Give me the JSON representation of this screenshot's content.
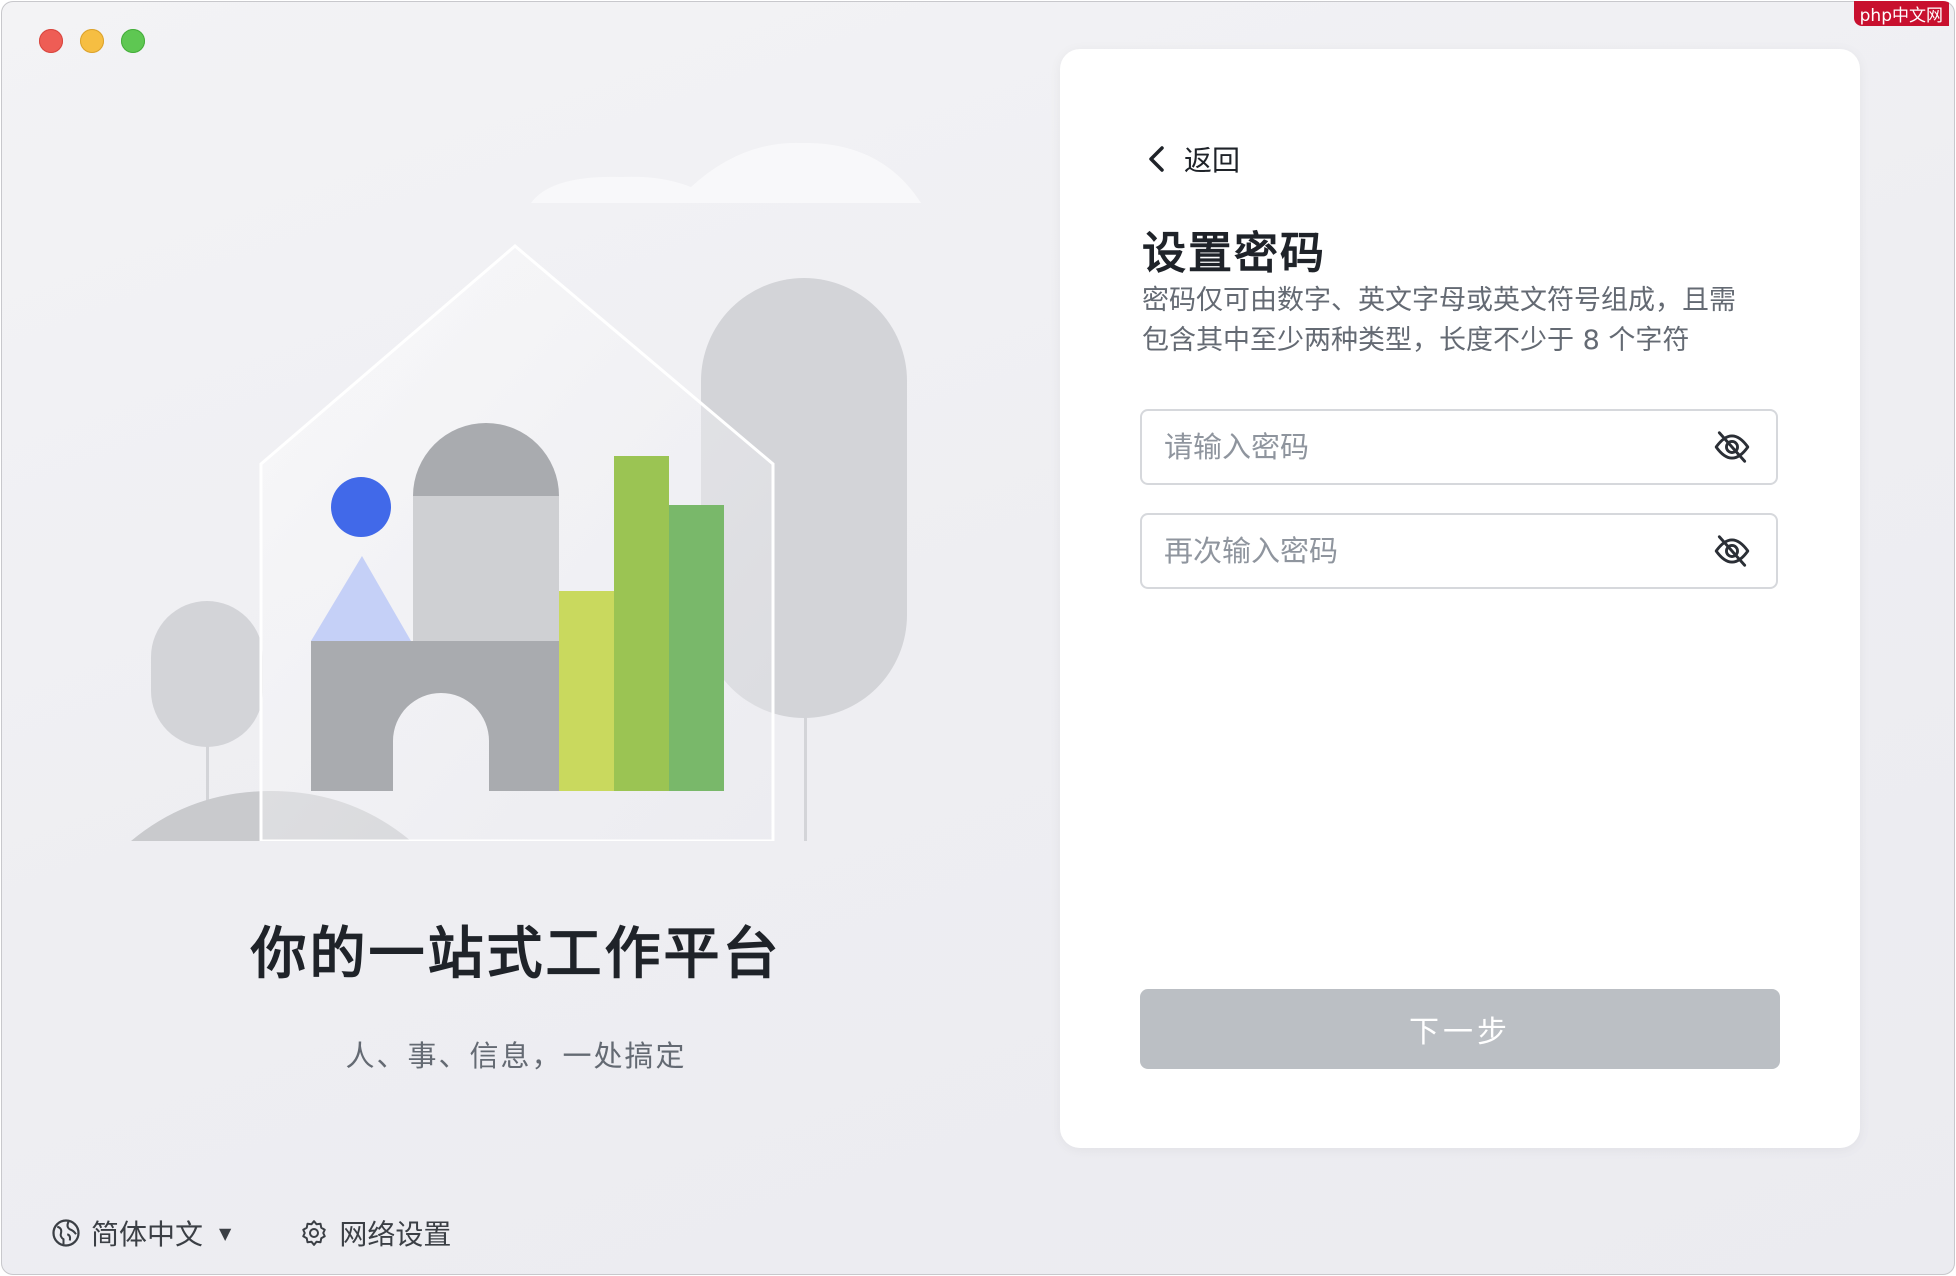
{
  "watermark": "php中文网",
  "left": {
    "title": "你的一站式工作平台",
    "subtitle": "人、事、信息，一处搞定"
  },
  "footer": {
    "language_label": "简体中文",
    "network_label": "网络设置"
  },
  "card": {
    "back_label": "返回",
    "title": "设置密码",
    "description": "密码仅可由数字、英文字母或英文符号组成，且需包含其中至少两种类型，长度不少于 8 个字符",
    "password_placeholder": "请输入密码",
    "confirm_placeholder": "再次输入密码",
    "next_label": "下一步"
  },
  "colors": {
    "primary_disabled": "#bbbfc4",
    "illustration_blue": "#4169e9",
    "illustration_green": "#9bc453"
  }
}
